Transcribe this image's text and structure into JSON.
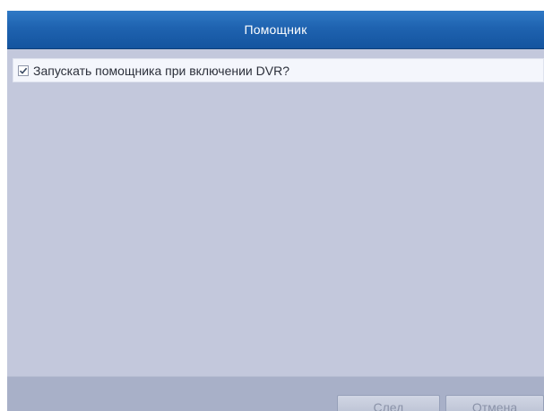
{
  "dialog": {
    "title": "Помощник",
    "startup_option": {
      "label": "Запускать помощника при включении DVR?",
      "checked": true
    },
    "buttons": {
      "next_label": "След",
      "cancel_label": "Отмена"
    }
  },
  "colors": {
    "titlebar": "#1f63b0",
    "body": "#c3c8dc",
    "footer": "#a8b0c8",
    "disabled_text": "#8a92a8"
  }
}
